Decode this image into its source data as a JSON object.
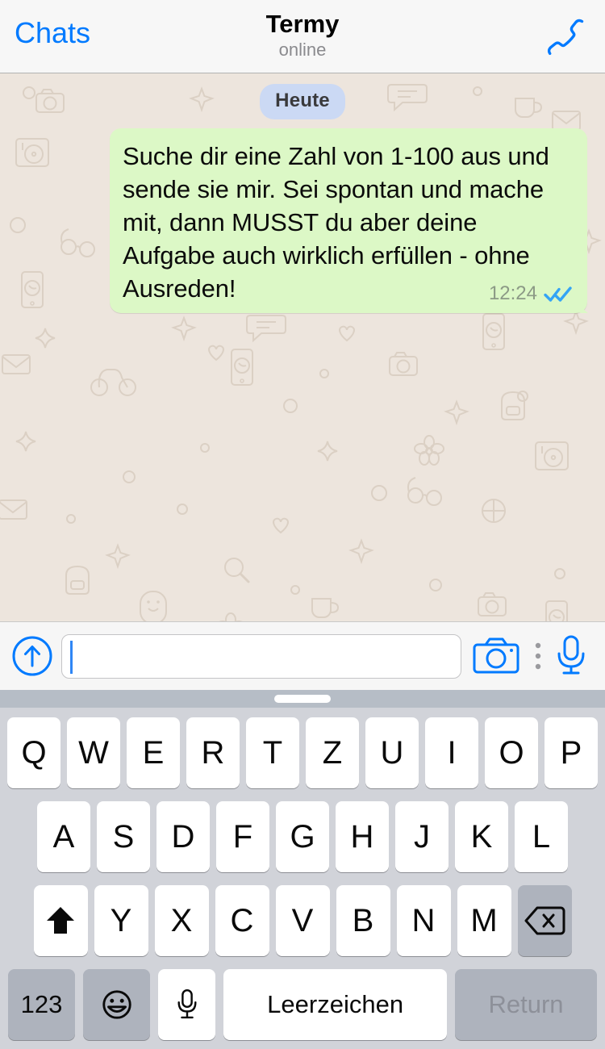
{
  "header": {
    "back_label": "Chats",
    "title": "Termy",
    "status": "online",
    "call_icon": "phone-icon"
  },
  "chat": {
    "day_divider": "Heute",
    "messages": [
      {
        "direction": "outgoing",
        "text": "Suche dir eine Zahl von 1-100 aus und sende sie mir. Sei spontan und mache mit, dann MUSST du aber deine Aufgabe auch wirklich erfüllen - ohne Ausreden!",
        "time": "12:24",
        "status": "read",
        "status_icon": "double-check-icon"
      }
    ],
    "background_style": "whatsapp-doodle-pattern",
    "colors": {
      "bubble_outgoing": "#DCF8C6",
      "chat_background": "#EDE5DD",
      "day_pill": "#CBD9F4",
      "read_tick": "#34A4F5"
    }
  },
  "input_bar": {
    "attach_icon": "arrow-up-circle-icon",
    "field_value": "",
    "field_placeholder": "",
    "camera_icon": "camera-icon",
    "more_icon": "more-vertical-icon",
    "mic_icon": "microphone-icon",
    "accent_color": "#007AFF"
  },
  "keyboard": {
    "layout": "QWERTZ",
    "language": "de",
    "handle": "keyboard-drag-handle",
    "row1": [
      "Q",
      "W",
      "E",
      "R",
      "T",
      "Z",
      "U",
      "I",
      "O",
      "P"
    ],
    "row2": [
      "A",
      "S",
      "D",
      "F",
      "G",
      "H",
      "J",
      "K",
      "L"
    ],
    "row3": [
      "Y",
      "X",
      "C",
      "V",
      "B",
      "N",
      "M"
    ],
    "shift_icon": "shift-arrow-icon",
    "backspace_icon": "backspace-icon",
    "numeric_label": "123",
    "emoji_icon": "smiley-icon",
    "dictation_icon": "microphone-icon",
    "space_label": "Leerzeichen",
    "return_label": "Return",
    "colors": {
      "background": "#D1D3D9",
      "key": "#FFFFFF",
      "function_key": "#AEB3BD",
      "return_text": "#8D9099"
    }
  }
}
